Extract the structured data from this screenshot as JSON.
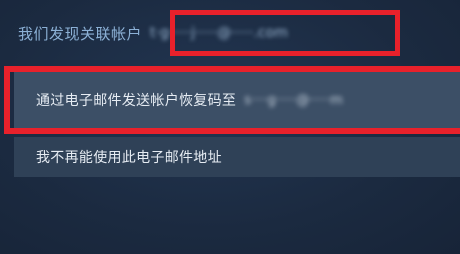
{
  "account_found": {
    "label": "我们发现关联帐户",
    "email_masked": "t·g·····j·····@·····.com"
  },
  "options": [
    {
      "label": "通过电子邮件发送帐户恢复码至",
      "email_masked": "s····g·····@·····m"
    },
    {
      "label": "我不再能使用此电子邮件地址"
    }
  ],
  "colors": {
    "background": "#1d2d43",
    "label_blue": "#8cb1d6",
    "option_bg": "#3c4f66",
    "highlight_red": "#e8212b"
  }
}
